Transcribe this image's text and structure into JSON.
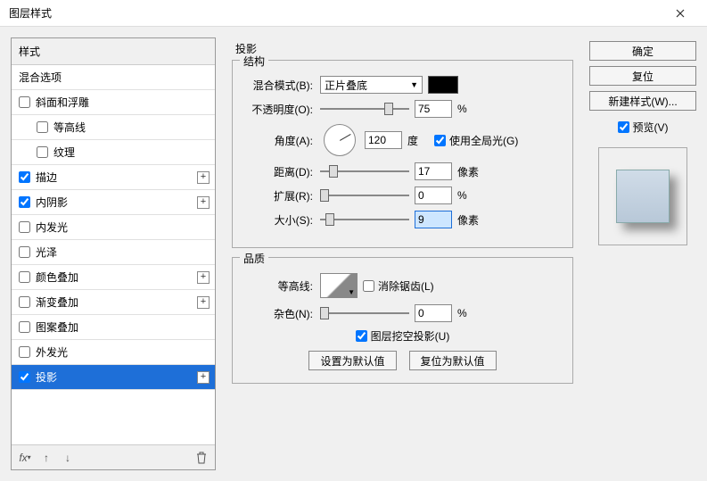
{
  "window": {
    "title": "图层样式"
  },
  "left": {
    "header": "样式",
    "items": [
      {
        "label": "混合选项",
        "checked": null,
        "plus": false,
        "indent": false
      },
      {
        "label": "斜面和浮雕",
        "checked": false,
        "plus": false,
        "indent": false
      },
      {
        "label": "等高线",
        "checked": false,
        "plus": false,
        "indent": true
      },
      {
        "label": "纹理",
        "checked": false,
        "plus": false,
        "indent": true
      },
      {
        "label": "描边",
        "checked": true,
        "plus": true,
        "indent": false
      },
      {
        "label": "内阴影",
        "checked": true,
        "plus": true,
        "indent": false
      },
      {
        "label": "内发光",
        "checked": false,
        "plus": false,
        "indent": false
      },
      {
        "label": "光泽",
        "checked": false,
        "plus": false,
        "indent": false
      },
      {
        "label": "颜色叠加",
        "checked": false,
        "plus": true,
        "indent": false
      },
      {
        "label": "渐变叠加",
        "checked": false,
        "plus": true,
        "indent": false
      },
      {
        "label": "图案叠加",
        "checked": false,
        "plus": false,
        "indent": false
      },
      {
        "label": "外发光",
        "checked": false,
        "plus": false,
        "indent": false
      },
      {
        "label": "投影",
        "checked": true,
        "plus": true,
        "indent": false,
        "selected": true
      }
    ]
  },
  "center": {
    "section_title": "投影",
    "structure_title": "结构",
    "blend_mode_label": "混合模式(B):",
    "blend_mode_value": "正片叠底",
    "opacity_label": "不透明度(O):",
    "opacity_value": "75",
    "opacity_unit": "%",
    "angle_label": "角度(A):",
    "angle_value": "120",
    "angle_unit": "度",
    "global_light_label": "使用全局光(G)",
    "global_light_checked": true,
    "distance_label": "距离(D):",
    "distance_value": "17",
    "distance_unit": "像素",
    "spread_label": "扩展(R):",
    "spread_value": "0",
    "spread_unit": "%",
    "size_label": "大小(S):",
    "size_value": "9",
    "size_unit": "像素",
    "quality_title": "品质",
    "contour_label": "等高线:",
    "antialias_label": "消除锯齿(L)",
    "antialias_checked": false,
    "noise_label": "杂色(N):",
    "noise_value": "0",
    "noise_unit": "%",
    "knockout_label": "图层挖空投影(U)",
    "knockout_checked": true,
    "set_default": "设置为默认值",
    "reset_default": "复位为默认值"
  },
  "right": {
    "ok": "确定",
    "cancel": "复位",
    "new_style": "新建样式(W)...",
    "preview_label": "预览(V)",
    "preview_checked": true
  }
}
